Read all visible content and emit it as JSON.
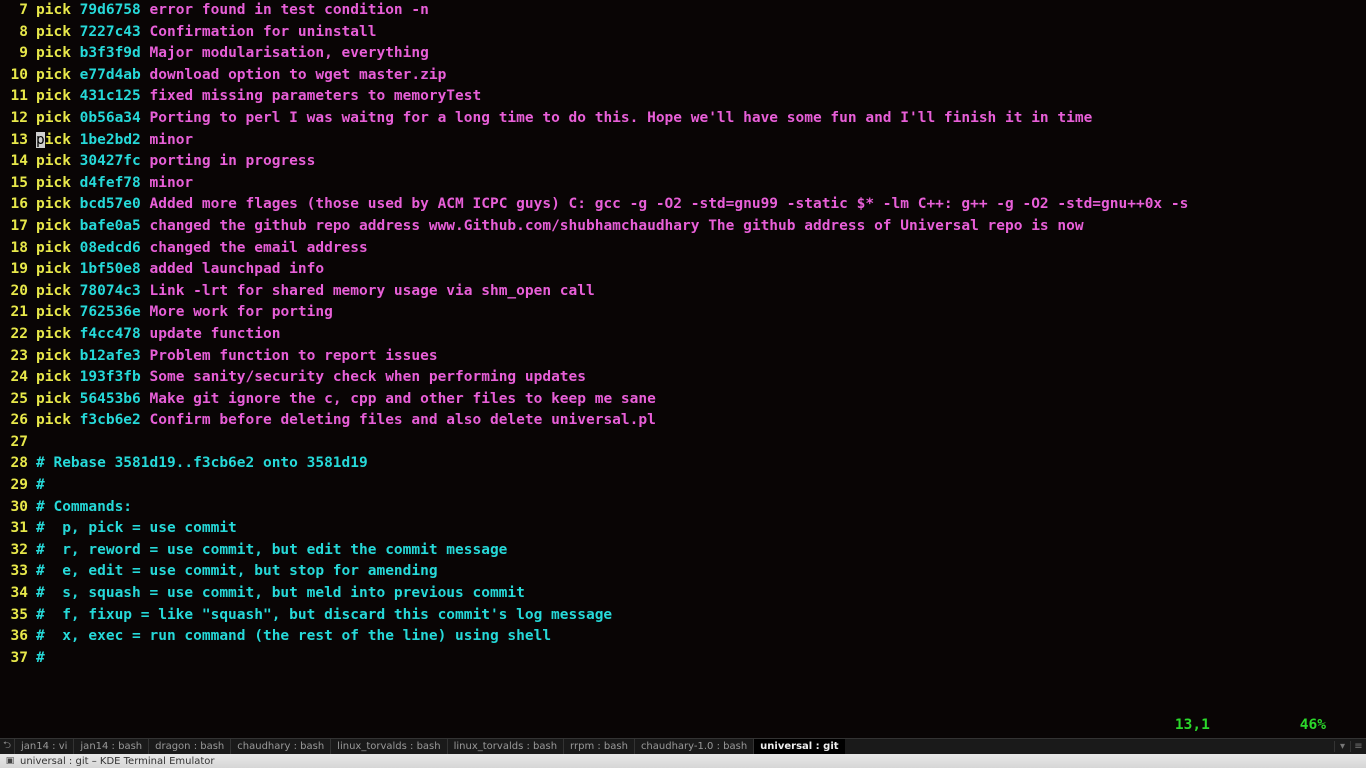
{
  "cursor": {
    "linenum": "13",
    "col": "1",
    "pct": "46%"
  },
  "lines": [
    {
      "n": "7",
      "cmd": "pick",
      "sha": "79d6758",
      "msg": "error found in test condition -n"
    },
    {
      "n": "8",
      "cmd": "pick",
      "sha": "7227c43",
      "msg": "Confirmation for uninstall"
    },
    {
      "n": "9",
      "cmd": "pick",
      "sha": "b3f3f9d",
      "msg": "Major modularisation, everything"
    },
    {
      "n": "10",
      "cmd": "pick",
      "sha": "e77d4ab",
      "msg": "download option to wget master.zip"
    },
    {
      "n": "11",
      "cmd": "pick",
      "sha": "431c125",
      "msg": "fixed missing parameters to memoryTest"
    },
    {
      "n": "12",
      "cmd": "pick",
      "sha": "0b56a34",
      "msg": "Porting to perl I was waitng for a long time to do this. Hope we'll have some fun and I'll finish it in time"
    },
    {
      "n": "13",
      "cmd": "pick",
      "sha": "1be2bd2",
      "msg": "minor",
      "cursor": true
    },
    {
      "n": "14",
      "cmd": "pick",
      "sha": "30427fc",
      "msg": "porting in progress"
    },
    {
      "n": "15",
      "cmd": "pick",
      "sha": "d4fef78",
      "msg": "minor"
    },
    {
      "n": "16",
      "cmd": "pick",
      "sha": "bcd57e0",
      "msg": "Added more flages (those used by ACM ICPC guys) C: gcc -g -O2 -std=gnu99 -static $* -lm C++: g++ -g -O2 -std=gnu++0x -s"
    },
    {
      "n": "17",
      "cmd": "pick",
      "sha": "bafe0a5",
      "msg": "changed the github repo address www.Github.com/shubhamchaudhary The github address of Universal repo is now"
    },
    {
      "n": "18",
      "cmd": "pick",
      "sha": "08edcd6",
      "msg": "changed the email address"
    },
    {
      "n": "19",
      "cmd": "pick",
      "sha": "1bf50e8",
      "msg": "added launchpad info"
    },
    {
      "n": "20",
      "cmd": "pick",
      "sha": "78074c3",
      "msg": "Link -lrt for shared memory usage via shm_open call"
    },
    {
      "n": "21",
      "cmd": "pick",
      "sha": "762536e",
      "msg": "More work for porting"
    },
    {
      "n": "22",
      "cmd": "pick",
      "sha": "f4cc478",
      "msg": "update function"
    },
    {
      "n": "23",
      "cmd": "pick",
      "sha": "b12afe3",
      "msg": "Problem function to report issues"
    },
    {
      "n": "24",
      "cmd": "pick",
      "sha": "193f3fb",
      "msg": "Some sanity/security check when performing updates"
    },
    {
      "n": "25",
      "cmd": "pick",
      "sha": "56453b6",
      "msg": "Make git ignore the c, cpp and other files to keep me sane"
    },
    {
      "n": "26",
      "cmd": "pick",
      "sha": "f3cb6e2",
      "msg": "Confirm before deleting files and also delete universal.pl"
    }
  ],
  "comments": [
    {
      "n": "27",
      "t": ""
    },
    {
      "n": "28",
      "t": "# Rebase 3581d19..f3cb6e2 onto 3581d19"
    },
    {
      "n": "29",
      "t": "#"
    },
    {
      "n": "30",
      "t": "# Commands:"
    },
    {
      "n": "31",
      "t": "#  p, pick = use commit"
    },
    {
      "n": "32",
      "t": "#  r, reword = use commit, but edit the commit message"
    },
    {
      "n": "33",
      "t": "#  e, edit = use commit, but stop for amending"
    },
    {
      "n": "34",
      "t": "#  s, squash = use commit, but meld into previous commit"
    },
    {
      "n": "35",
      "t": "#  f, fixup = like \"squash\", but discard this commit's log message"
    },
    {
      "n": "36",
      "t": "#  x, exec = run command (the rest of the line) using shell"
    },
    {
      "n": "37",
      "t": "#"
    }
  ],
  "status_pos": "13,1",
  "status_pct": "46%",
  "tabs": [
    {
      "label": "jan14 : vi",
      "active": false
    },
    {
      "label": "jan14 : bash",
      "active": false
    },
    {
      "label": "dragon : bash",
      "active": false
    },
    {
      "label": "chaudhary : bash",
      "active": false
    },
    {
      "label": "linux_torvalds : bash",
      "active": false
    },
    {
      "label": "linux_torvalds : bash",
      "active": false
    },
    {
      "label": "rrpm : bash",
      "active": false
    },
    {
      "label": "chaudhary-1.0 : bash",
      "active": false
    },
    {
      "label": "universal : git",
      "active": true
    }
  ],
  "window_title": "universal : git – KDE Terminal Emulator",
  "tabbar_newbtn": "⮌",
  "winicons": {
    "min": "▾",
    "max": "▴",
    "close": "✕"
  }
}
